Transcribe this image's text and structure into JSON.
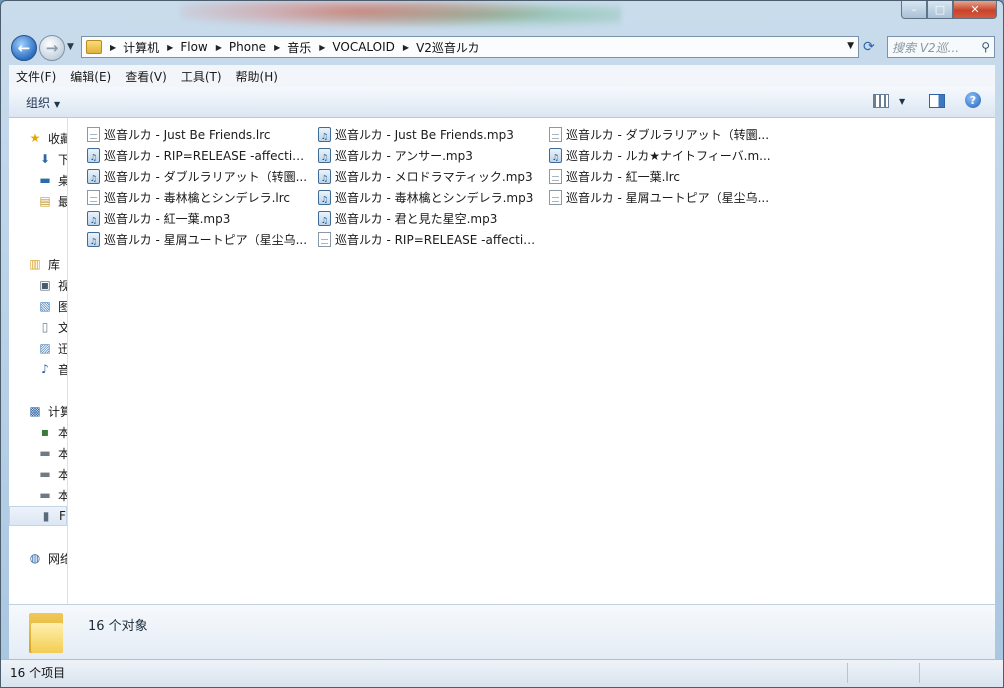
{
  "window": {
    "min_label": "–",
    "max_label": "□",
    "close_label": "✕"
  },
  "nav": {
    "back_icon": "back-arrow-icon",
    "forward_icon": "forward-arrow-icon",
    "breadcrumbs": [
      "计算机",
      "Flow",
      "Phone",
      "音乐",
      "VOCALOID",
      "V2巡音ルカ"
    ],
    "search_placeholder": "搜索 V2巡..."
  },
  "menu": [
    "文件(F)",
    "编辑(E)",
    "查看(V)",
    "工具(T)",
    "帮助(H)"
  ],
  "toolbar": {
    "organize_label": "组织"
  },
  "sidebar": [
    {
      "label": "收藏夹",
      "icon": "star-icon"
    },
    {
      "label": "下载",
      "icon": "downloads-folder-icon"
    },
    {
      "label": "桌面",
      "icon": "desktop-icon"
    },
    {
      "label": "最近访问的位置",
      "icon": "recent-places-icon"
    },
    {
      "label": "库",
      "icon": "libraries-icon"
    },
    {
      "label": "视频",
      "icon": "video-icon"
    },
    {
      "label": "图片",
      "icon": "pictures-icon"
    },
    {
      "label": "文档",
      "icon": "documents-icon"
    },
    {
      "label": "迅雷下载",
      "icon": "download-folder-icon"
    },
    {
      "label": "音乐",
      "icon": "music-icon"
    },
    {
      "label": "计算机",
      "icon": "computer-icon"
    },
    {
      "label": "本地磁盘",
      "icon": "system-drive-icon"
    },
    {
      "label": "本地磁盘",
      "icon": "drive-icon"
    },
    {
      "label": "本地磁盘",
      "icon": "drive-icon"
    },
    {
      "label": "本地磁盘",
      "icon": "drive-icon"
    },
    {
      "label": "Flow",
      "icon": "phone-device-icon"
    },
    {
      "label": "网络",
      "icon": "network-icon"
    }
  ],
  "files": [
    {
      "name": "巡音ルカ - Just Be Friends.lrc",
      "type": "lrc"
    },
    {
      "name": "巡音ルカ - RIP=RELEASE -affection-....",
      "type": "mp3"
    },
    {
      "name": "巡音ルカ - ダブルラリアット（转圜...",
      "type": "mp3"
    },
    {
      "name": "巡音ルカ - 毒林檎とシンデレラ.lrc",
      "type": "lrc"
    },
    {
      "name": "巡音ルカ - 紅一葉.mp3",
      "type": "mp3"
    },
    {
      "name": "巡音ルカ - 星屑ユートピア（星尘乌...",
      "type": "mp3"
    },
    {
      "name": "巡音ルカ - Just Be Friends.mp3",
      "type": "mp3"
    },
    {
      "name": "巡音ルカ - アンサー.mp3",
      "type": "mp3"
    },
    {
      "name": "巡音ルカ - メロドラマティック.mp3",
      "type": "mp3"
    },
    {
      "name": "巡音ルカ - 毒林檎とシンデレラ.mp3",
      "type": "mp3"
    },
    {
      "name": "巡音ルカ - 君と見た星空.mp3",
      "type": "mp3"
    },
    {
      "name": "巡音ルカ - RIP=RELEASE -affection-....",
      "type": "lrc"
    },
    {
      "name": "巡音ルカ - ダブルラリアット（转圜...",
      "type": "lrc"
    },
    {
      "name": "巡音ルカ - ルカ★ナイトフィーバ.m...",
      "type": "mp3"
    },
    {
      "name": "巡音ルカ - 紅一葉.lrc",
      "type": "lrc"
    },
    {
      "name": "巡音ルカ - 星屑ユートピア（星尘乌...",
      "type": "lrc"
    }
  ],
  "details": {
    "count_text": "16 个对象"
  },
  "status": {
    "text": "16 个项目"
  }
}
